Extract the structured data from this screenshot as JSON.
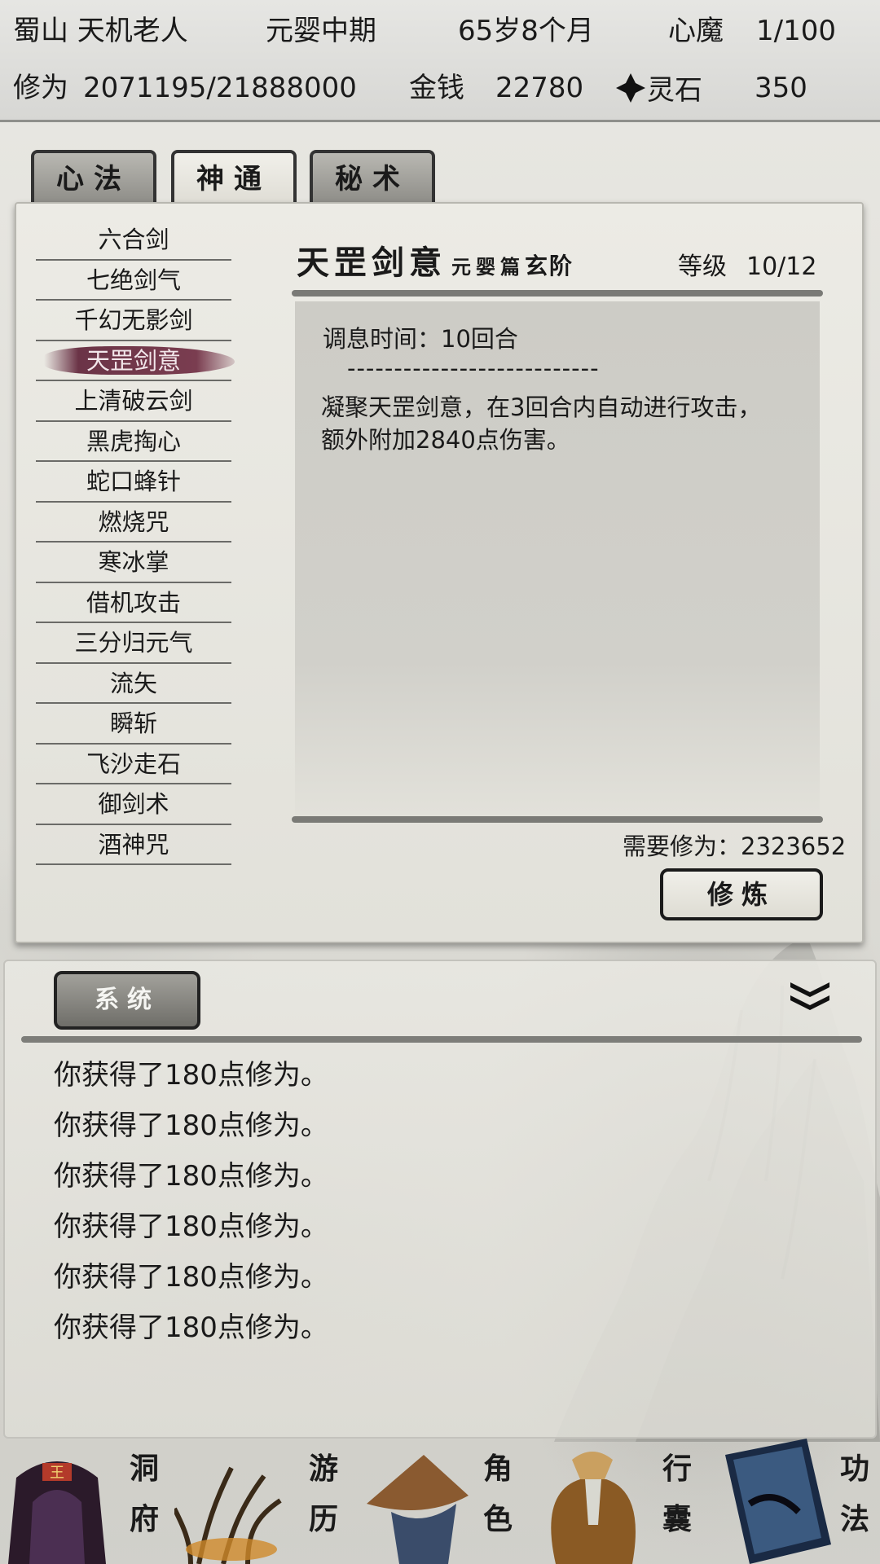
{
  "header": {
    "sect_name": "蜀山 天机老人",
    "realm": "元婴中期",
    "age": "65岁8个月",
    "heart_demon_label": "心魔",
    "heart_demon_value": "1/100",
    "cultivation_label": "修为",
    "cultivation_value": "2071195/21888000",
    "money_label": "金钱",
    "money_value": "22780",
    "spirit_stone_label": "灵石",
    "spirit_stone_value": "350"
  },
  "tabs": [
    {
      "label": "心法"
    },
    {
      "label": "神通"
    },
    {
      "label": "秘术"
    }
  ],
  "skill_list": [
    "六合剑",
    "七绝剑气",
    "千幻无影剑",
    "天罡剑意",
    "上清破云剑",
    "黑虎掏心",
    "蛇口蜂针",
    "燃烧咒",
    "寒冰掌",
    "借机攻击",
    "三分归元气",
    "流矢",
    "瞬斩",
    "飞沙走石",
    "御剑术",
    "酒神咒"
  ],
  "detail": {
    "name": "天罡剑意",
    "chapter": "元婴篇",
    "rank": "玄阶",
    "level_label": "等级",
    "level_value": "10/12",
    "cooldown": "调息时间：10回合",
    "separator": "---------------------------",
    "desc_line1": "凝聚天罡剑意，在3回合内自动进行攻击，",
    "desc_line2": "额外附加2840点伤害。",
    "required": "需要修为：2323652",
    "cultivate_button": "修炼"
  },
  "log": {
    "tab_label": "系统",
    "lines": [
      "你获得了180点修为。",
      "你获得了180点修为。",
      "你获得了180点修为。",
      "你获得了180点修为。",
      "你获得了180点修为。",
      "你获得了180点修为。"
    ]
  },
  "nav": {
    "cave": [
      "洞",
      "府"
    ],
    "travel": [
      "游",
      "历"
    ],
    "character": [
      "角",
      "色"
    ],
    "bag": [
      "行",
      "囊"
    ],
    "skills": [
      "功",
      "法"
    ]
  }
}
